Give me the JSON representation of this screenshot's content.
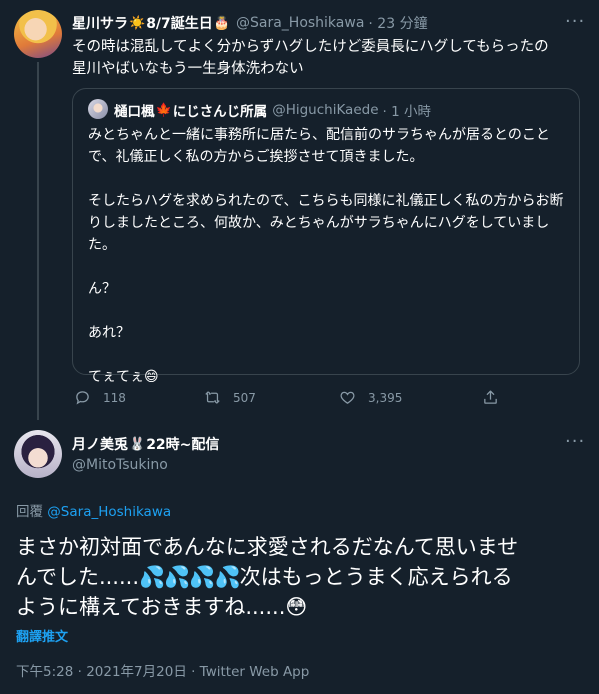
{
  "tweet": {
    "author_name": "星川サラ",
    "author_emoji_1": "☀️",
    "author_suffix": "8/7誕生日",
    "author_emoji_2": "🎂",
    "handle": "@Sara_Hoshikawa",
    "time": "· 23 分鐘",
    "more_icon": "···",
    "text_line1": "その時は混乱してよく分からずハグしたけど委員長にハグしてもらったの",
    "text_line2": "星川やばいなもう一生身体洗わない"
  },
  "quote": {
    "author_name": "樋口楓",
    "author_emoji": "🍁",
    "author_suffix": "にじさんじ所属",
    "handle": "@HiguchiKaede",
    "time": "· 1 小時",
    "paragraphs": [
      "みとちゃんと一緒に事務所に居たら、配信前のサラちゃんが居るとのことで、礼儀正しく私の方からご挨拶させて頂きました。",
      "そしたらハグを求められたので、こちらも同様に礼儀正しく私の方からお断りしましたところ、何故か、みとちゃんがサラちゃんにハグをしていました。",
      "ん？",
      "あれ？"
    ],
    "last_text": "てぇてぇ",
    "last_emoji": "😄"
  },
  "actions": {
    "reply_count": "118",
    "retweet_count": "507",
    "like_count": "3,395",
    "icons": [
      "reply-icon",
      "retweet-icon",
      "like-icon",
      "share-icon"
    ]
  },
  "reply_tweet": {
    "author_name": "月ノ美兎",
    "author_emoji": "🐰",
    "author_suffix": "22時~配信",
    "handle": "@MitoTsukino",
    "more_icon": "···",
    "reply_prefix": "回覆",
    "reply_to": "@Sara_Hoshikawa",
    "text_line1": "まさか初対面であんなに求愛されるだなんて思いませ",
    "text_line2_a": "んでした......",
    "drops": "💦💦💦💦",
    "text_line2_b": "次はもっとうまく応えられる",
    "text_line3": "ように構えておきますね......",
    "end_emoji": "😳",
    "translate_label": "翻譯推文",
    "timestamp": "下午5:28 · 2021年7月20日 · Twitter Web App"
  },
  "colors": {
    "background": "#15202b",
    "secondary_text": "#8899a6",
    "link": "#1da1f2",
    "border": "#38444d"
  }
}
